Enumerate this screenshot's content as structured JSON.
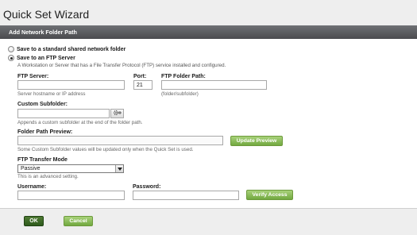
{
  "window": {
    "title": "Quick Set Wizard"
  },
  "section": {
    "header": "Add Network Folder Path"
  },
  "options": {
    "shared_folder_label": "Save to a standard shared network folder",
    "ftp_label": "Save to an FTP Server",
    "ftp_description": "A Workstation or Server that has a File Transfer Protocol (FTP) service installed and configured."
  },
  "ftp_server": {
    "label": "FTP Server:",
    "value": "",
    "hint": "Server hostname or IP address"
  },
  "port": {
    "label": "Port:",
    "value": "21"
  },
  "ftp_folder_path": {
    "label": "FTP Folder Path:",
    "value": "",
    "hint": "(folder/subfolder)"
  },
  "custom_subfolder": {
    "label": "Custom Subfolder:",
    "value": "",
    "hint": "Appends a custom subfolder at the end of the folder path.",
    "button_icon": "gear-plus-icon"
  },
  "folder_path_preview": {
    "label": "Folder Path Preview:",
    "value": "",
    "hint": "Some Custom Subfolder values will be updated only when the Quick Set is used.",
    "update_button": "Update Preview"
  },
  "transfer_mode": {
    "label": "FTP Transfer Mode",
    "selected": "Passive",
    "hint": "This is an advanced setting."
  },
  "username": {
    "label": "Username:",
    "value": ""
  },
  "password": {
    "label": "Password:",
    "value": ""
  },
  "verify_button": "Verify Access",
  "footer": {
    "ok": "OK",
    "cancel": "Cancel"
  },
  "colors": {
    "header_bg": "#5a5b5e",
    "green_button": "#8bbd56",
    "ok_button": "#3a6626"
  }
}
